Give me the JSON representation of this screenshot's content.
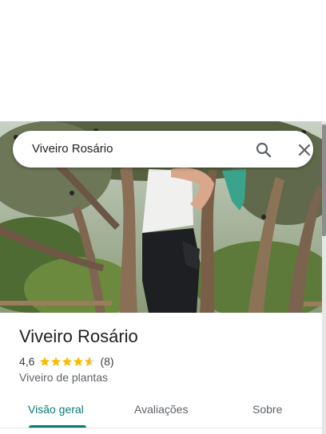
{
  "search": {
    "value": "Viveiro Rosário"
  },
  "place": {
    "name": "Viveiro Rosário",
    "rating": "4,6",
    "stars": 4.6,
    "review_count": "(8)",
    "category": "Viveiro de plantas"
  },
  "tabs": [
    {
      "label": "Visão geral",
      "active": true
    },
    {
      "label": "Avaliações",
      "active": false
    },
    {
      "label": "Sobre",
      "active": false
    }
  ],
  "colors": {
    "accent": "#0b7a75",
    "star": "#fbbc04"
  },
  "icons": {
    "search": "search-icon",
    "close": "close-icon",
    "star": "star-icon"
  }
}
